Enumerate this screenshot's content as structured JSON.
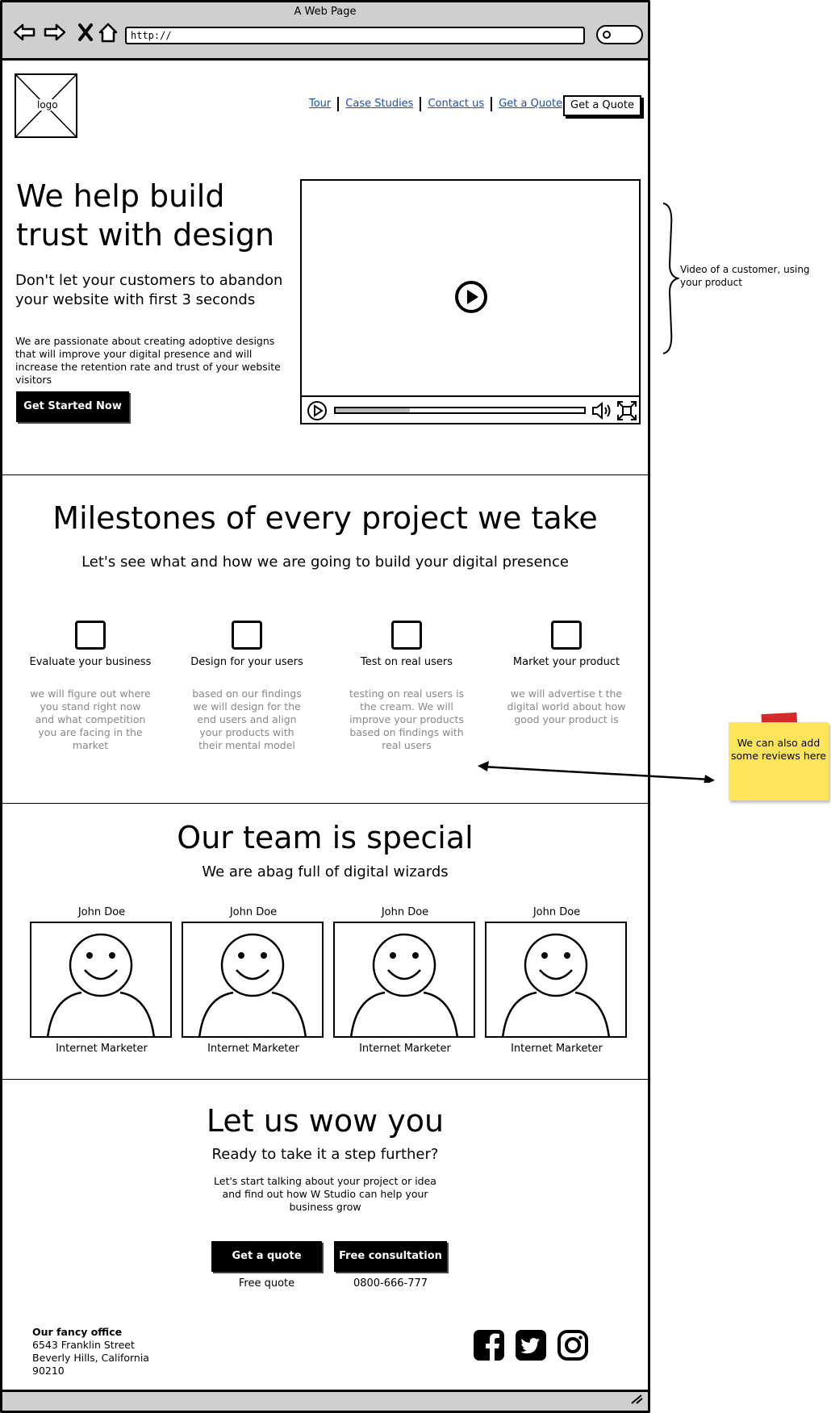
{
  "window": {
    "title": "A Web Page",
    "url": "http://"
  },
  "header": {
    "logo_label": "logo",
    "nav": [
      "Tour",
      "Case Studies",
      "Contact us",
      "Get a Quote"
    ],
    "quote_button": "Get a Quote"
  },
  "hero": {
    "title": "We help build trust with design",
    "subtitle": "Don't let your customers to abandon your website with first 3 seconds",
    "body": "We are passionate about creating adoptive designs that will improve your digital presence and will increase the retention rate and trust of your website visitors",
    "cta": "Get Started Now",
    "video_progress": 0.3
  },
  "annotations": {
    "video_note": "Video of a customer, using your product",
    "sticky_note": "We can also add some reviews here"
  },
  "milestones": {
    "title": "Milestones of every project we take",
    "subtitle": "Let's see what and how we are going to build your digital presence",
    "items": [
      {
        "label": "Evaluate your business",
        "desc": "we will figure out where you stand right now and what competition you are facing in the market"
      },
      {
        "label": "Design for your users",
        "desc": "based on our findings we will design for the end users and align your products with their mental model"
      },
      {
        "label": "Test on real users",
        "desc": "testing on real users is the cream. We will improve your products based on findings with real users"
      },
      {
        "label": "Market your product",
        "desc": "we will advertise t the digital world about how good your product is"
      }
    ]
  },
  "team": {
    "title": "Our team is special",
    "subtitle": "We are abag full of digital wizards",
    "members": [
      {
        "name": "John Doe",
        "role": "Internet Marketer"
      },
      {
        "name": "John Doe",
        "role": "Internet Marketer"
      },
      {
        "name": "John Doe",
        "role": "Internet Marketer"
      },
      {
        "name": "John Doe",
        "role": "Internet Marketer"
      }
    ]
  },
  "wow": {
    "title": "Let us wow you",
    "subtitle": "Ready to take it a step further?",
    "body": "Let's start talking about your project or idea and find out how W Studio can help your business grow",
    "quote_button": "Get a quote",
    "consult_button": "Free consultation",
    "quote_caption": "Free quote",
    "phone": "0800-666-777"
  },
  "footer": {
    "office_title": "Our fancy office",
    "address_line1": "6543 Franklin Street",
    "address_line2": "Beverly Hills, California",
    "address_line3": "90210",
    "social": [
      "facebook-icon",
      "twitter-icon",
      "instagram-icon"
    ]
  }
}
